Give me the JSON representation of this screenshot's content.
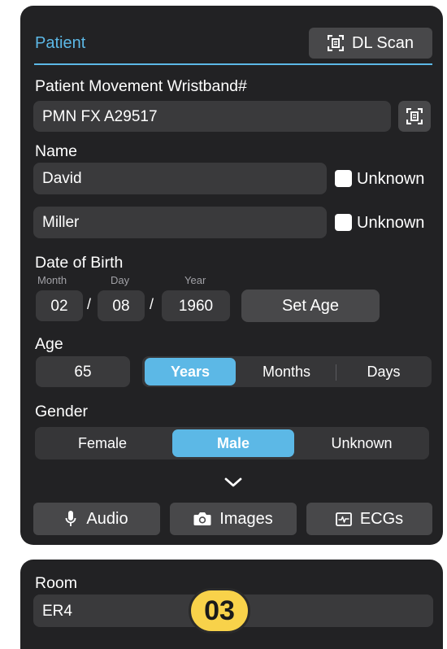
{
  "patient_section": {
    "title": "Patient",
    "dl_scan_label": "DL Scan",
    "accent_color": "#5cb8e6"
  },
  "wristband": {
    "label": "Patient Movement Wristband#",
    "value": "PMN FX A29517"
  },
  "name": {
    "label": "Name",
    "first_name": "David",
    "last_name": "Miller",
    "unknown_label": "Unknown"
  },
  "dob": {
    "label": "Date of Birth",
    "month_label": "Month",
    "day_label": "Day",
    "year_label": "Year",
    "month": "02",
    "day": "08",
    "year": "1960",
    "separator": "/",
    "set_age_label": "Set Age"
  },
  "age": {
    "label": "Age",
    "value": "65",
    "units": [
      "Years",
      "Months",
      "Days"
    ],
    "selected_unit": "Years"
  },
  "gender": {
    "label": "Gender",
    "options": [
      "Female",
      "Male",
      "Unknown"
    ],
    "selected": "Male"
  },
  "media": {
    "audio_label": "Audio",
    "images_label": "Images",
    "ecgs_label": "ECGs"
  },
  "room": {
    "label": "Room",
    "value": "ER4"
  },
  "callout": {
    "number": "03",
    "color": "#f8d24a"
  },
  "icons": [
    "scan-icon",
    "chevron-down-icon",
    "microphone-icon",
    "camera-icon",
    "ecg-icon"
  ]
}
